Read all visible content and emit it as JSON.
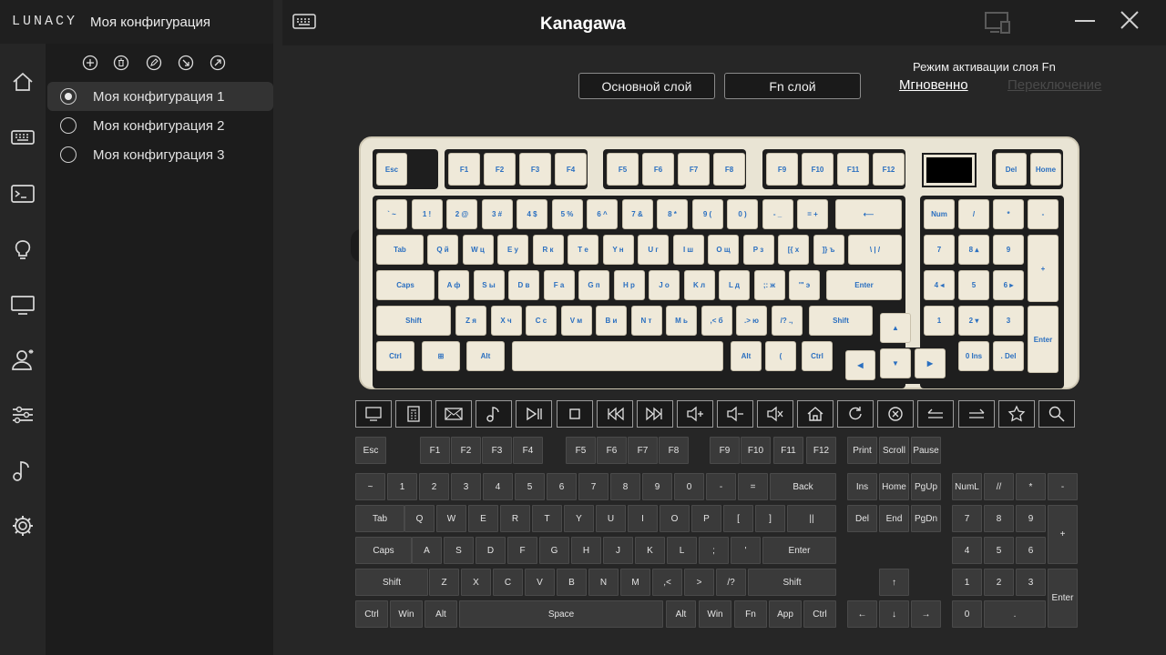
{
  "app": {
    "brand": "LUNACY",
    "config_title": "Моя конфигурация",
    "device": "Kanagawa"
  },
  "nav": [
    "home-icon",
    "keyboard-icon",
    "terminal-icon",
    "bulb-icon",
    "monitor-icon",
    "user-icon",
    "sliders-icon",
    "music-icon",
    "gear-icon"
  ],
  "configs": [
    {
      "label": "Моя конфигурация 1",
      "selected": true
    },
    {
      "label": "Моя конфигурация 2",
      "selected": false
    },
    {
      "label": "Моя конфигурация 3",
      "selected": false
    }
  ],
  "layers": {
    "base": "Основной слой",
    "fn": "Fn слой"
  },
  "mode": {
    "label": "Режим активации слоя Fn",
    "instant": "Мгновенно",
    "toggle": "Переключение"
  },
  "keyboard": {
    "row0": [
      "Esc",
      "F1",
      "F2",
      "F3",
      "F4",
      "F5",
      "F6",
      "F7",
      "F8",
      "F9",
      "F10",
      "F11",
      "F12",
      "Del",
      "Home"
    ],
    "row1": [
      "` ~",
      "1 !",
      "2 @",
      "3 #",
      "4 $",
      "5 %",
      "6 ^",
      "7 &",
      "8 *",
      "9 (",
      "0 )",
      "- _",
      "= +",
      "⟵",
      "Num",
      "/",
      "*",
      "-"
    ],
    "row2": [
      "Tab",
      "Q й",
      "W ц",
      "E у",
      "R к",
      "T е",
      "Y н",
      "U г",
      "I ш",
      "O щ",
      "P з",
      "[{ х",
      "]} ъ",
      "\\ | /",
      "7",
      "8 ▴",
      "9",
      "+"
    ],
    "row3": [
      "Caps",
      "A ф",
      "S ы",
      "D в",
      "F а",
      "G п",
      "H р",
      "J о",
      "K л",
      "L д",
      ";: ж",
      "'\" э",
      "Enter",
      "4 ◂",
      "5",
      "6 ▸"
    ],
    "row4": [
      "Shift",
      "Z я",
      "X ч",
      "C с",
      "V м",
      "B и",
      "N т",
      "M ь",
      ",< б",
      ".> ю",
      "/? .,",
      "Shift",
      "▲",
      "1",
      "2 ▾",
      "3",
      "Enter"
    ],
    "row5": [
      "Ctrl",
      "⊞",
      "Alt",
      "",
      "Alt",
      "(",
      "Ctrl",
      "◀",
      "▼",
      "▶",
      "0 Ins",
      ". Del"
    ]
  },
  "toolbar_icons": [
    "monitor-icon",
    "calculator-icon",
    "mail-icon",
    "music-note-icon",
    "play-pause-icon",
    "stop-icon",
    "prev-track-icon",
    "next-track-icon",
    "volume-up-icon",
    "volume-down-icon",
    "mute-icon",
    "home-icon",
    "refresh-icon",
    "close-tab-icon",
    "back-icon",
    "forward-icon",
    "star-icon",
    "search-icon"
  ],
  "std_keys": {
    "r0": [
      "Esc",
      "F1",
      "F2",
      "F3",
      "F4",
      "F5",
      "F6",
      "F7",
      "F8",
      "F9",
      "F10",
      "F11",
      "F12",
      "Print",
      "Scroll",
      "Pause"
    ],
    "r1": [
      "~",
      "1",
      "2",
      "3",
      "4",
      "5",
      "6",
      "7",
      "8",
      "9",
      "0",
      "-",
      "=",
      "Back",
      "Ins",
      "Home",
      "PgUp",
      "NumL",
      "//",
      "*",
      "-"
    ],
    "r2": [
      "Tab",
      "Q",
      "W",
      "E",
      "R",
      "T",
      "Y",
      "U",
      "I",
      "O",
      "P",
      "[",
      "]",
      "||",
      "Del",
      "End",
      "PgDn",
      "7",
      "8",
      "9",
      "+"
    ],
    "r3": [
      "Caps",
      "A",
      "S",
      "D",
      "F",
      "G",
      "H",
      "J",
      "K",
      "L",
      ";",
      "'",
      "Enter",
      "4",
      "5",
      "6"
    ],
    "r4": [
      "Shift",
      "Z",
      "X",
      "C",
      "V",
      "B",
      "N",
      "M",
      ",<",
      ">",
      "/?",
      "Shift",
      "↑",
      "1",
      "2",
      "3",
      "Enter"
    ],
    "r5": [
      "Ctrl",
      "Win",
      "Alt",
      "Space",
      "Alt",
      "Win",
      "Fn",
      "App",
      "Ctrl",
      "←",
      "↓",
      "→",
      "0",
      "."
    ]
  }
}
